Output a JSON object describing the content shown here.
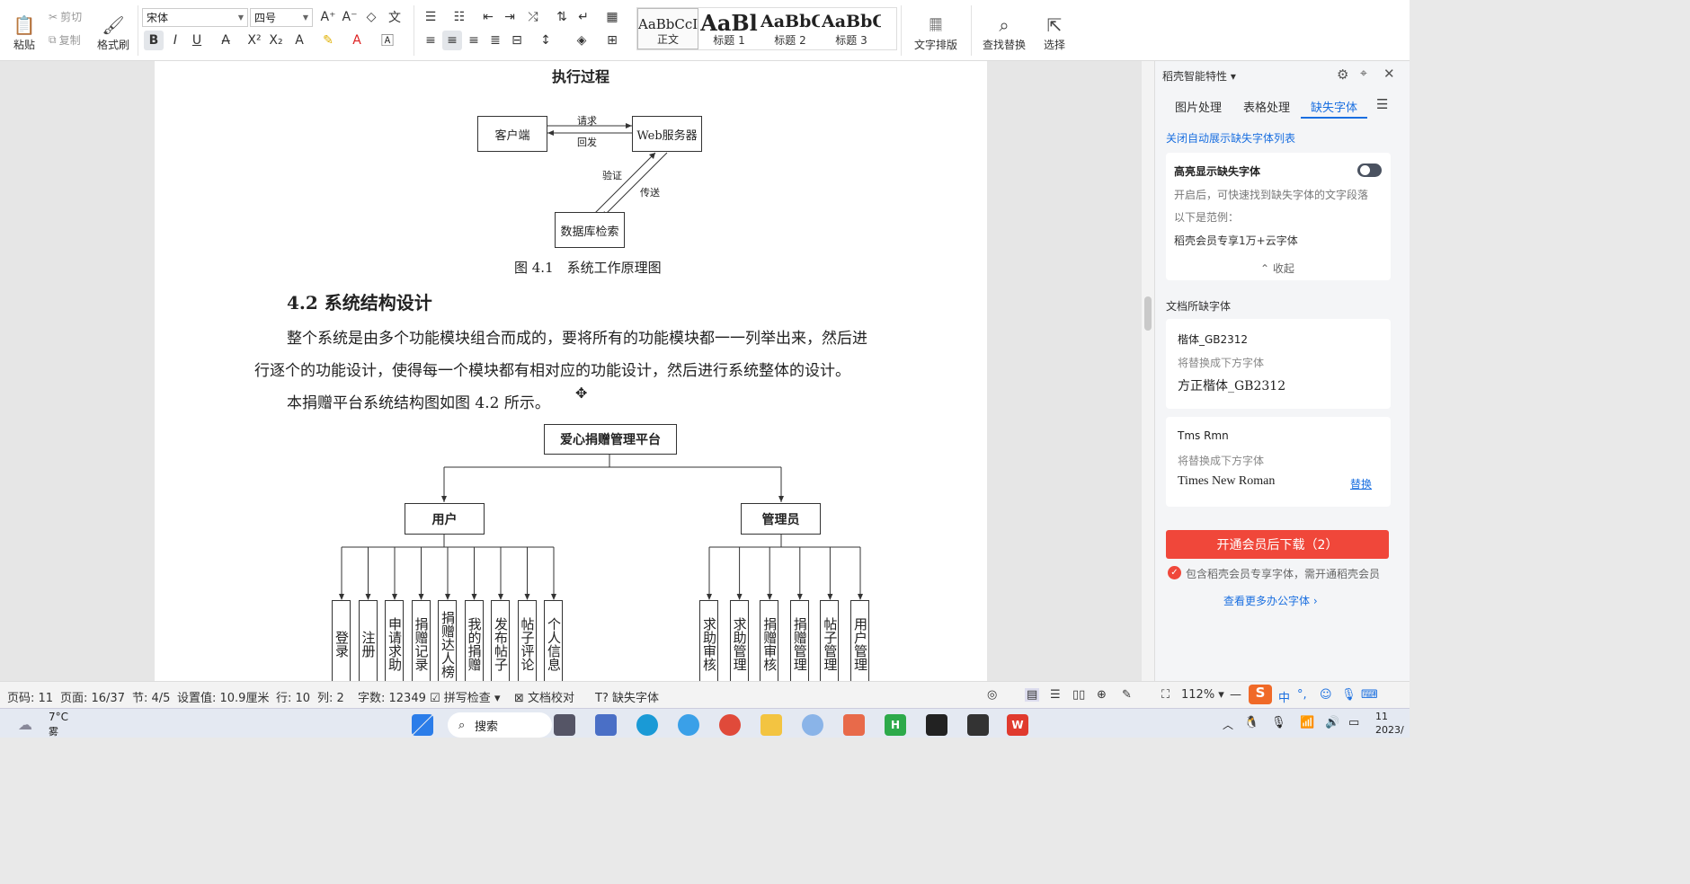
{
  "ribbon": {
    "paste": "粘贴",
    "cut": "剪切",
    "copy": "复制",
    "format_painter": "格式刷",
    "font_name": "宋体",
    "font_size": "四号",
    "styles": [
      {
        "preview": "AaBbCcI",
        "label": "正文"
      },
      {
        "preview": "AaBl",
        "label": "标题 1"
      },
      {
        "preview": "AaBbC",
        "label": "标题 2"
      },
      {
        "preview": "AaBbC",
        "label": "标题 3"
      }
    ],
    "text_layout": "文字排版",
    "find_replace": "查找替换",
    "select": "选择"
  },
  "doc": {
    "exec_title": "执行过程",
    "fig1": {
      "client": "客户端",
      "server": "Web服务器",
      "request": "请求",
      "reply": "回发",
      "verify": "验证",
      "transfer": "传送",
      "db": "数据库检索",
      "caption": "图 4.1　系统工作原理图"
    },
    "heading": "4.2  系统结构设计",
    "para1_line1": "整个系统是由多个功能模块组合而成的，要将所有的功能模块都一一列举出来，然后进",
    "para1_line2": "行逐个的功能设计，使得每一个模块都有相对应的功能设计，然后进行系统整体的设计。",
    "para2": "本捐赠平台系统结构图如图 4.2 所示。",
    "fig2": {
      "root": "爱心捐赠管理平台",
      "user": "用户",
      "admin": "管理员",
      "user_leaves": [
        "登录",
        "注册",
        "申请求助",
        "捐赠记录",
        "捐赠达人榜",
        "我的捐赠",
        "发布帖子",
        "帖子评论",
        "个人信息"
      ],
      "admin_leaves": [
        "求助审核",
        "求助管理",
        "捐赠审核",
        "捐赠管理",
        "帖子管理",
        "用户管理"
      ]
    }
  },
  "panel": {
    "title": "稻壳智能特性",
    "tabs": [
      "图片处理",
      "表格处理",
      "缺失字体"
    ],
    "close_auto": "关闭自动展示缺失字体列表",
    "highlight_title": "高亮显示缺失字体",
    "highlight_desc": "开启后，可快速找到缺失字体的文字段落",
    "example_label": "以下是范例：",
    "example_text": "稻壳会员专享1万+云字体",
    "collapse": "收起",
    "missing_section": "文档所缺字体",
    "fonts": [
      {
        "name": "楷体_GB2312",
        "hint": "将替换成下方字体",
        "replacement": "方正楷体_GB2312",
        "action": ""
      },
      {
        "name": "Tms Rmn",
        "hint": "将替换成下方字体",
        "replacement": "Times New Roman",
        "action": "替换"
      }
    ],
    "download_btn": "开通会员后下载（2）",
    "member_note": "包含稻壳会员专享字体，需开通稻壳会员",
    "more_fonts": "查看更多办公字体 ›"
  },
  "status": {
    "page_code": "页码: 11",
    "page": "页面: 16/37",
    "section": "节: 4/5",
    "setting": "设置值: 10.9厘米",
    "row": "行: 10",
    "col": "列: 2",
    "word_count": "字数: 12349",
    "spell": "拼写检查",
    "proof": "文档校对",
    "missing_font": "缺失字体",
    "zoom": "112%"
  },
  "taskbar": {
    "temp": "7°C",
    "weather": "雾",
    "search": "搜索",
    "ime": "中",
    "time": "11",
    "date": "2023/"
  },
  "colors": {
    "accent": "#1a6fe0",
    "download": "#f0473a"
  }
}
